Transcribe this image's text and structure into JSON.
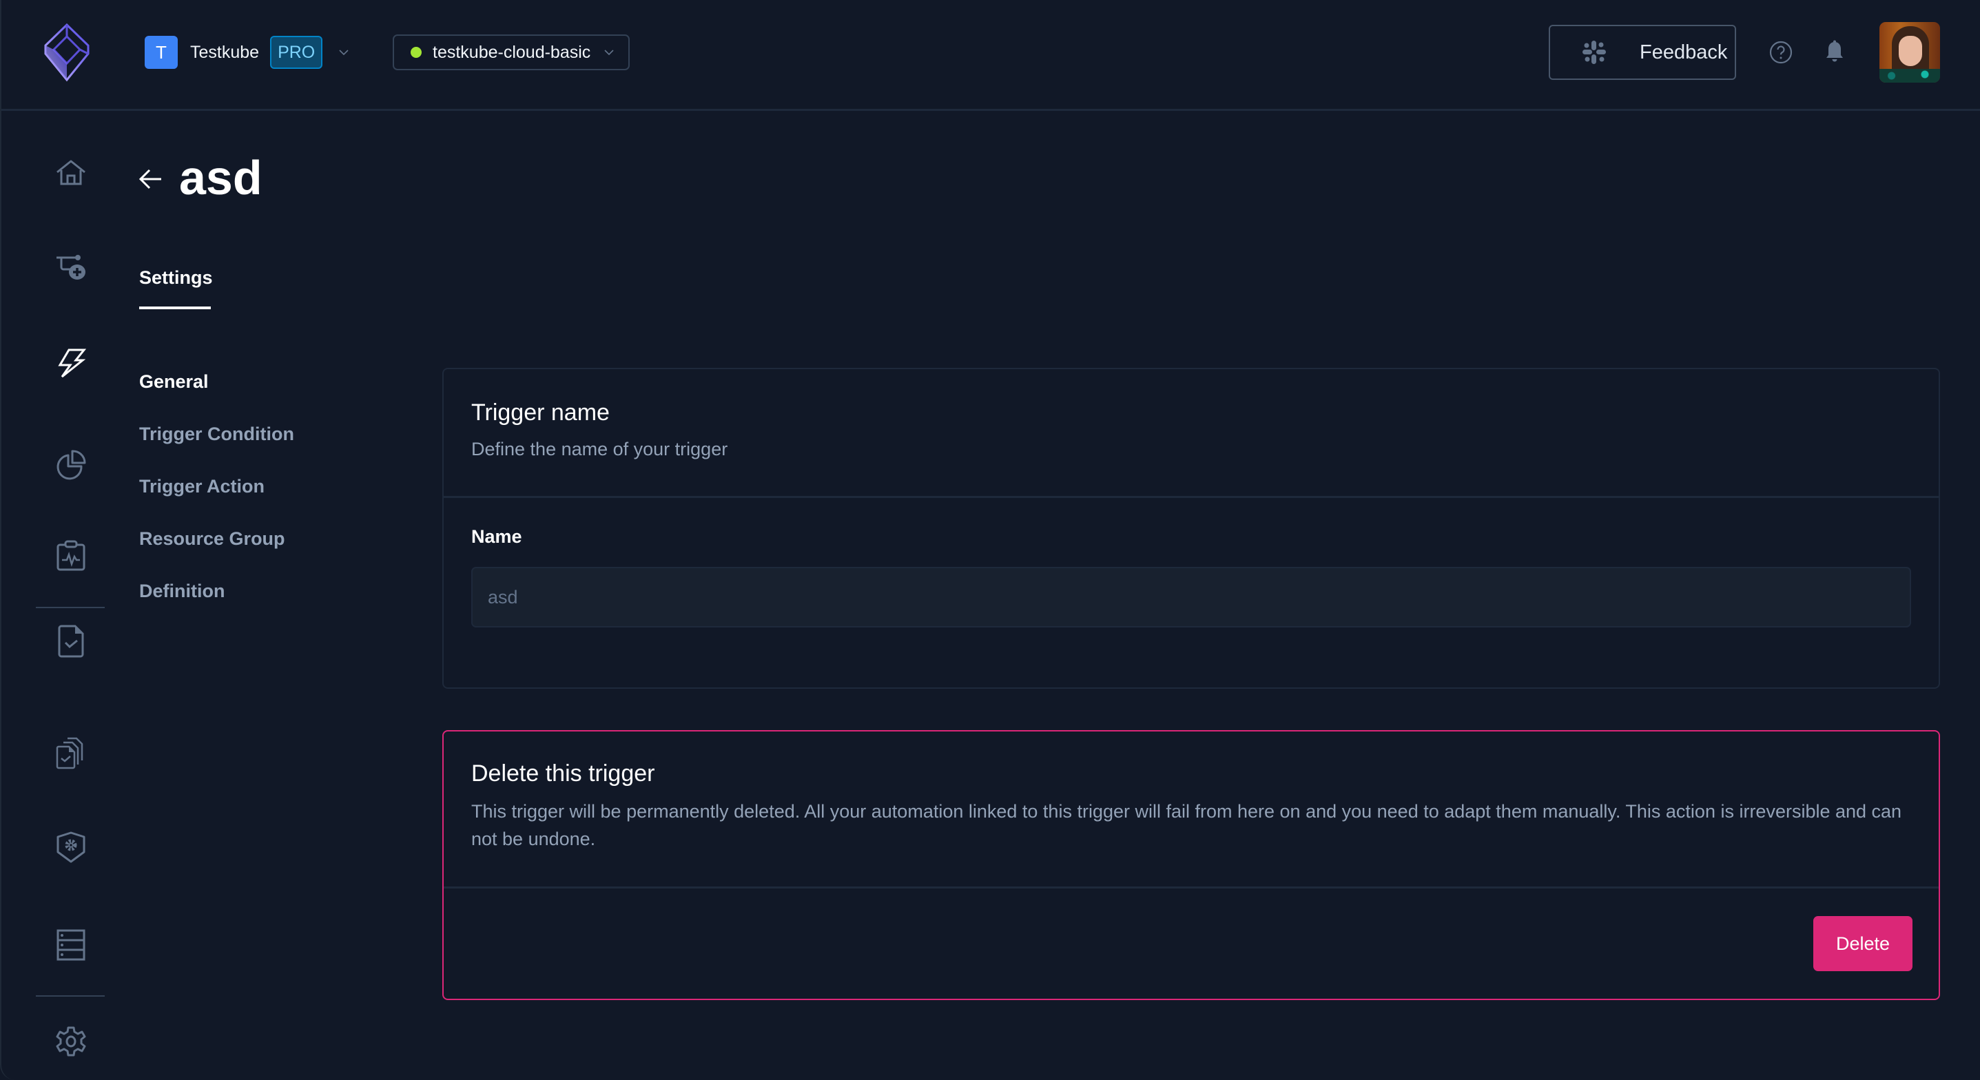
{
  "header": {
    "logo_icon": "testkube-logo-icon",
    "org": {
      "initial": "T",
      "name": "Testkube",
      "plan_badge": "PRO"
    },
    "environment": {
      "name": "testkube-cloud-basic",
      "status": "connected",
      "status_color": "#a3e635"
    },
    "feedback_label": "Feedback",
    "feedback_icon": "slack-icon",
    "help_icon": "help-circle-icon",
    "notifications_icon": "bell-icon",
    "avatar_alt": "User avatar"
  },
  "sidebar": {
    "items": [
      {
        "name": "home",
        "icon": "home-icon",
        "active": false
      },
      {
        "name": "test-workflows",
        "icon": "workflow-add-icon",
        "active": false
      },
      {
        "name": "triggers",
        "icon": "bolt-icon",
        "active": true
      },
      {
        "name": "insights",
        "icon": "pie-chart-icon",
        "active": false
      },
      {
        "name": "status-pages",
        "icon": "clipboard-pulse-icon",
        "active": false
      },
      {
        "name": "tests",
        "icon": "file-check-icon",
        "active": false
      },
      {
        "name": "test-suites",
        "icon": "files-check-icon",
        "active": false
      },
      {
        "name": "security",
        "icon": "shield-gear-icon",
        "active": false
      },
      {
        "name": "resources",
        "icon": "server-icon",
        "active": false
      },
      {
        "name": "settings",
        "icon": "gear-icon",
        "active": false
      }
    ]
  },
  "page": {
    "title": "asd",
    "back_icon": "arrow-left-icon",
    "tabs": [
      {
        "label": "Settings",
        "active": true
      }
    ]
  },
  "settings_nav": {
    "items": [
      {
        "label": "General",
        "active": true
      },
      {
        "label": "Trigger Condition",
        "active": false
      },
      {
        "label": "Trigger Action",
        "active": false
      },
      {
        "label": "Resource Group",
        "active": false
      },
      {
        "label": "Definition",
        "active": false
      }
    ]
  },
  "trigger_name_card": {
    "title": "Trigger name",
    "description": "Define the name of your trigger",
    "field_label": "Name",
    "field_value": "asd"
  },
  "delete_card": {
    "title": "Delete this trigger",
    "description": "This trigger will be permanently deleted. All your automation linked to this trigger will fail from here on and you need to adapt them manually. This action is irreversible and can not be undone.",
    "button_label": "Delete",
    "accent_color": "#db2777"
  }
}
